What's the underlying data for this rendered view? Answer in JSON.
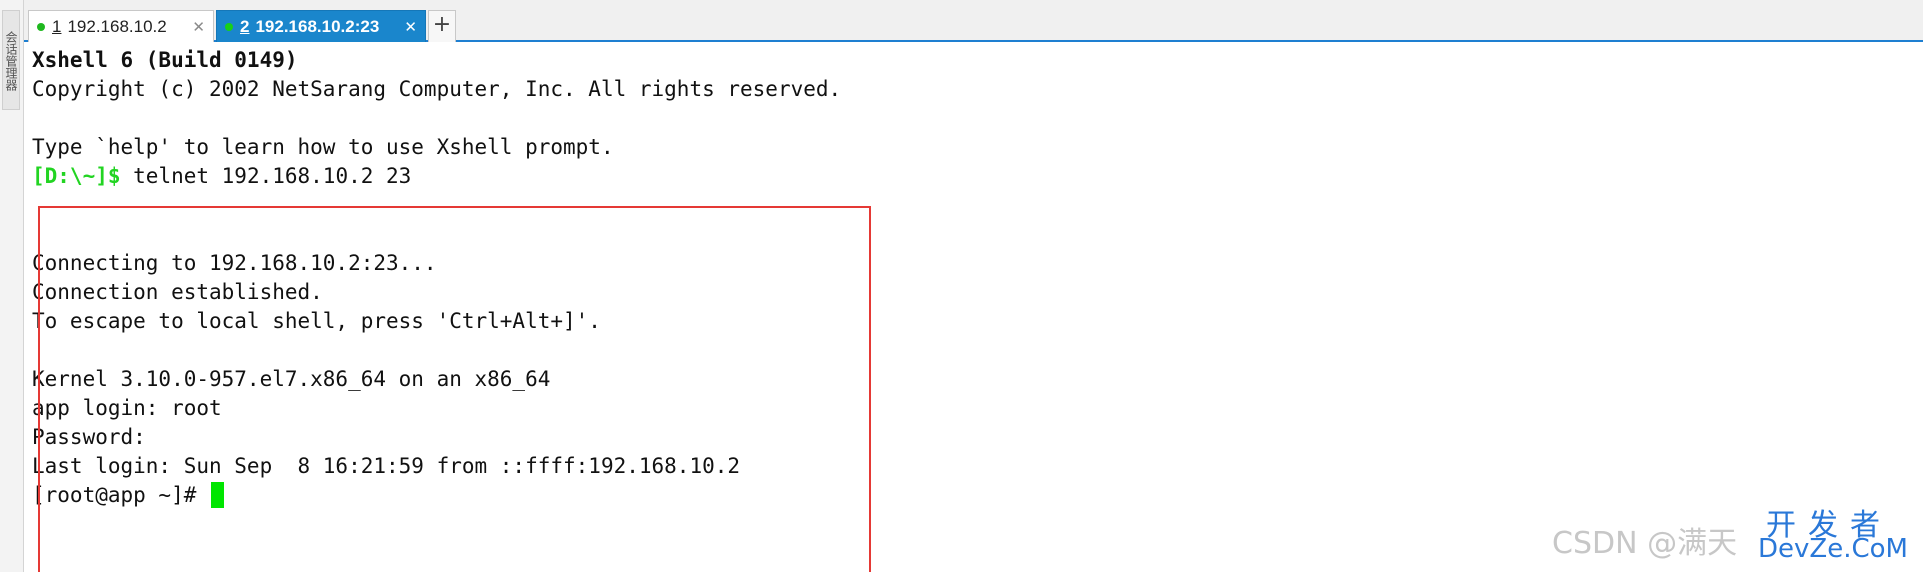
{
  "sidebar": {
    "label": "会话管理器"
  },
  "tabs": [
    {
      "number": "1",
      "label": "192.168.10.2",
      "close": "✕",
      "active": false
    },
    {
      "number": "2",
      "label": "192.168.10.2:23",
      "close": "✕",
      "active": true
    }
  ],
  "add_tab_label": "+",
  "terminal": {
    "banner_title": "Xshell 6 (Build 0149)",
    "copyright": "Copyright (c) 2002 NetSarang Computer, Inc. All rights reserved.",
    "help_hint": "Type `help' to learn how to use Xshell prompt.",
    "local_prompt": "[D:\\~]$",
    "command": " telnet 192.168.10.2 23",
    "connecting": "Connecting to 192.168.10.2:23...",
    "established": "Connection established.",
    "escape_hint": "To escape to local shell, press 'Ctrl+Alt+]'.",
    "kernel": "Kernel 3.10.0-957.el7.x86_64 on an x86_64",
    "login": "app login: root",
    "password": "Password:",
    "last_login": "Last login: Sun Sep  8 16:21:59 from ::ffff:192.168.10.2",
    "remote_prompt": "[root@app ~]# "
  },
  "watermark": {
    "csdn": "CSDN @满天",
    "logo_zh": "开发者",
    "logo_en": "DevZe.CoM"
  },
  "colors": {
    "prompt_green": "#22d422",
    "cursor_green": "#00e600",
    "active_tab_blue": "#1a86cc",
    "highlight_red": "#e53935",
    "tab_dot_green": "#1fb81f"
  }
}
